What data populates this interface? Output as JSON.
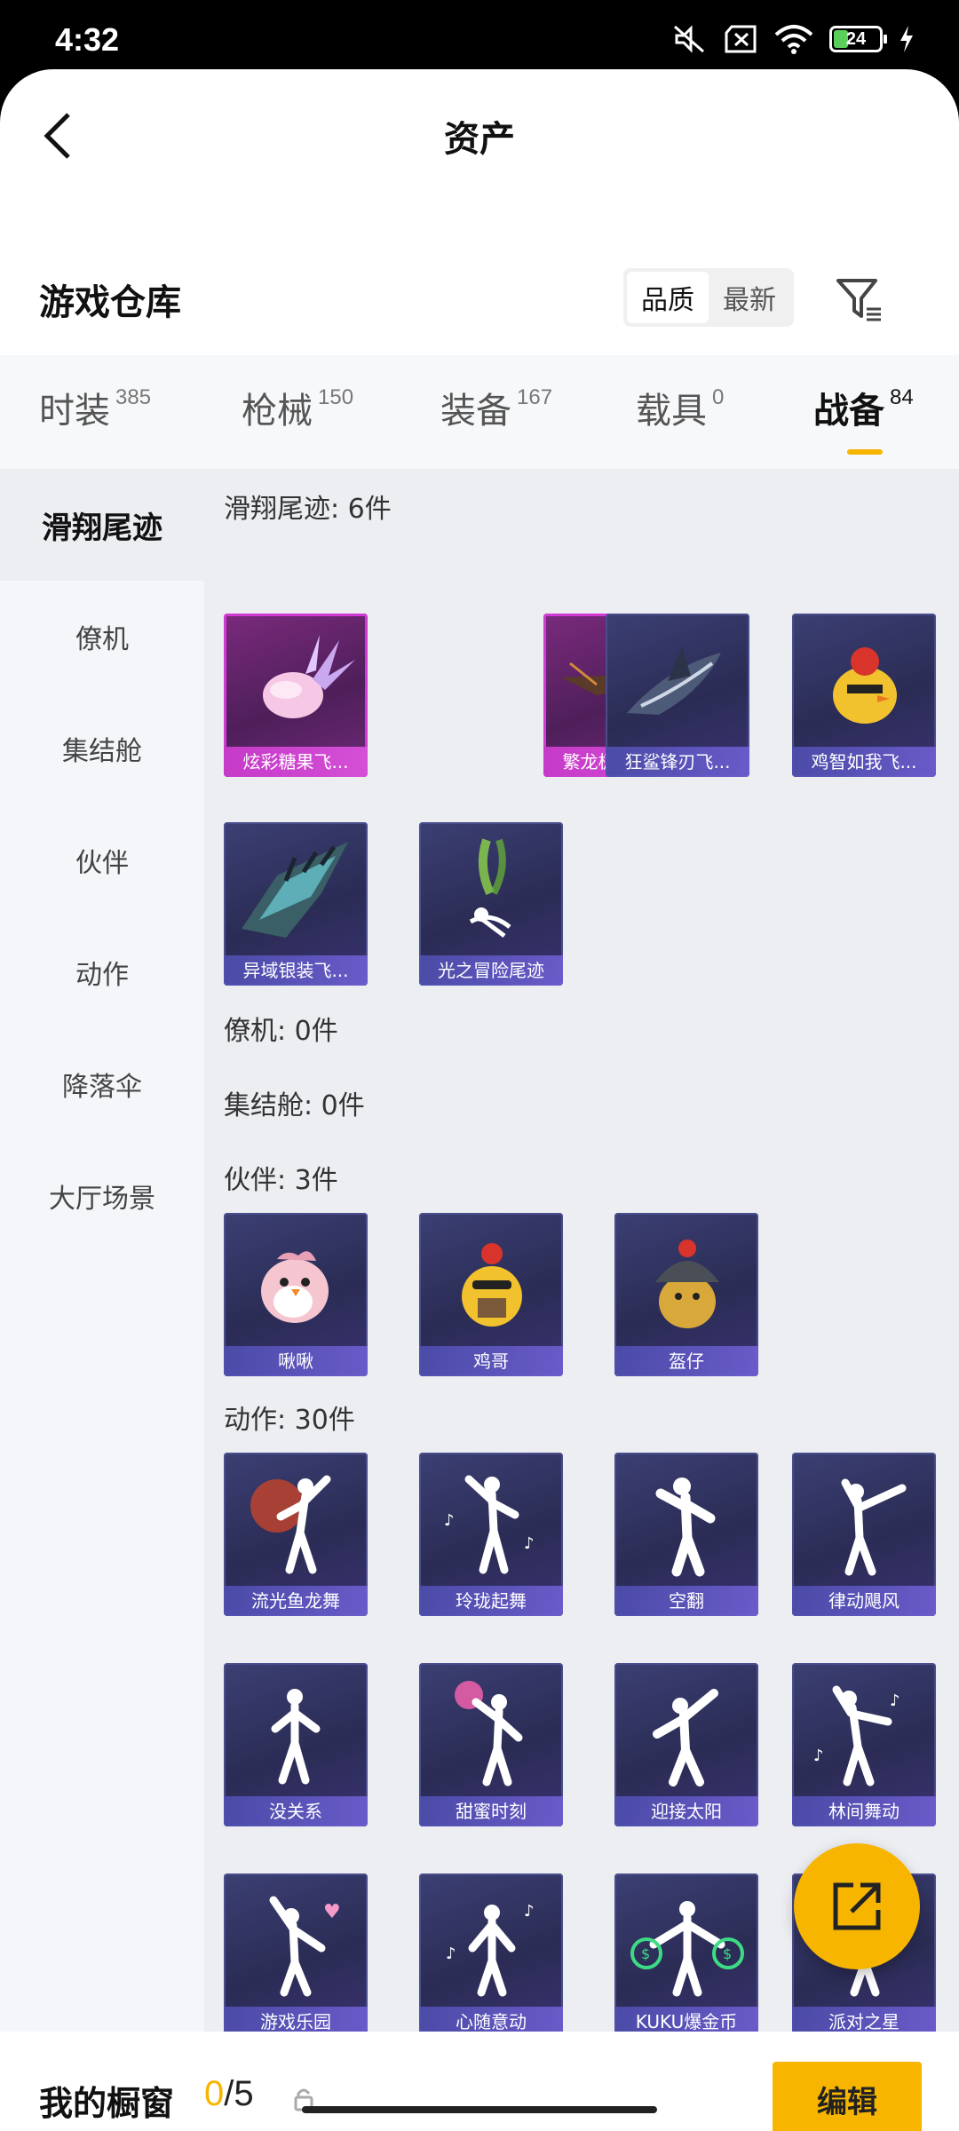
{
  "status": {
    "time": "4:32",
    "battery": "24"
  },
  "header": {
    "title": "资产"
  },
  "warehouse": {
    "title": "游戏仓库",
    "sort_options": [
      "品质",
      "最新"
    ]
  },
  "tabs": [
    {
      "label": "时装",
      "count": "385"
    },
    {
      "label": "枪械",
      "count": "150"
    },
    {
      "label": "装备",
      "count": "167"
    },
    {
      "label": "载具",
      "count": "0"
    },
    {
      "label": "战备",
      "count": "84"
    }
  ],
  "sidebar": {
    "items": [
      "滑翔尾迹",
      "僚机",
      "集结舱",
      "伙伴",
      "动作",
      "降落伞",
      "大厅场景"
    ]
  },
  "sections": {
    "glide": {
      "label": "滑翔尾迹: 6件",
      "items": [
        "炫彩糖果飞...",
        "繁龙极客飞...",
        "狂鲨锋刃飞...",
        "鸡智如我飞...",
        "异域银装飞...",
        "光之冒险尾迹"
      ]
    },
    "wingman": {
      "label": "僚机: 0件"
    },
    "capsule": {
      "label": "集结舱: 0件"
    },
    "partner": {
      "label": "伙伴: 3件",
      "items": [
        "啾啾",
        "鸡哥",
        "盔仔"
      ]
    },
    "emote": {
      "label": "动作: 30件",
      "items": [
        "流光鱼龙舞",
        "玲珑起舞",
        "空翻",
        "律动飓风",
        "没关系",
        "甜蜜时刻",
        "迎接太阳",
        "林间舞动",
        "游戏乐园",
        "心随意动",
        "KUKU爆金币",
        "派对之星"
      ]
    }
  },
  "showcase": {
    "label": "我的橱窗",
    "current": "0",
    "total": "/5",
    "edit_label": "编辑"
  },
  "colors": {
    "accent": "#f7b500",
    "pink_card": "#d23ad6",
    "card_bg": "#2f3060"
  }
}
